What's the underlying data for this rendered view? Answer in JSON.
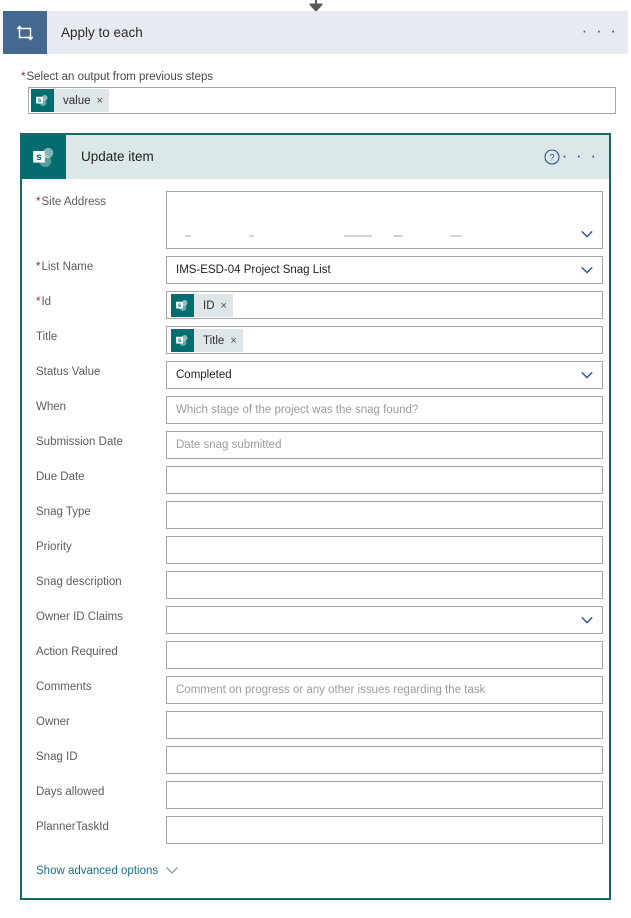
{
  "loop": {
    "icon": "repeat-loop-icon",
    "title": "Apply to each",
    "ellipsis": "· · ·",
    "select_output_label": "Select an output from previous steps",
    "required_star": "*",
    "token": {
      "label": "value",
      "close": "×",
      "icon": "sharepoint-icon"
    }
  },
  "action": {
    "icon": "sharepoint-icon",
    "title": "Update item",
    "help_icon": "help-circle-icon",
    "ellipsis": "· · ·",
    "advanced_options_label": "Show advanced options",
    "advanced_chevron": "chevron-down-icon",
    "fields": [
      {
        "label": "Site Address",
        "required": true,
        "type": "dropdown-redacted",
        "value": "",
        "placeholder": "",
        "tall": true
      },
      {
        "label": "List Name",
        "required": true,
        "type": "dropdown",
        "value": "IMS-ESD-04 Project Snag List",
        "placeholder": ""
      },
      {
        "label": "Id",
        "required": true,
        "type": "token",
        "value": "",
        "token": {
          "label": "ID",
          "close": "×"
        }
      },
      {
        "label": "Title",
        "required": false,
        "type": "token",
        "value": "",
        "token": {
          "label": "Title",
          "close": "×"
        }
      },
      {
        "label": "Status Value",
        "required": false,
        "type": "dropdown",
        "value": "Completed",
        "placeholder": ""
      },
      {
        "label": "When",
        "required": false,
        "type": "text",
        "value": "",
        "placeholder": "Which stage of the project was the snag found?"
      },
      {
        "label": "Submission Date",
        "required": false,
        "type": "text",
        "value": "",
        "placeholder": "Date snag submitted"
      },
      {
        "label": "Due Date",
        "required": false,
        "type": "text",
        "value": "",
        "placeholder": ""
      },
      {
        "label": "Snag Type",
        "required": false,
        "type": "text",
        "value": "",
        "placeholder": ""
      },
      {
        "label": "Priority",
        "required": false,
        "type": "text",
        "value": "",
        "placeholder": ""
      },
      {
        "label": "Snag description",
        "required": false,
        "type": "text",
        "value": "",
        "placeholder": ""
      },
      {
        "label": "Owner ID Claims",
        "required": false,
        "type": "dropdown",
        "value": "",
        "placeholder": ""
      },
      {
        "label": "Action Required",
        "required": false,
        "type": "text",
        "value": "",
        "placeholder": ""
      },
      {
        "label": "Comments",
        "required": false,
        "type": "text",
        "value": "",
        "placeholder": "Comment on progress or any other issues regarding the task"
      },
      {
        "label": "Owner",
        "required": false,
        "type": "text",
        "value": "",
        "placeholder": ""
      },
      {
        "label": "Snag ID",
        "required": false,
        "type": "text",
        "value": "",
        "placeholder": ""
      },
      {
        "label": "Days allowed",
        "required": false,
        "type": "text",
        "value": "",
        "placeholder": ""
      },
      {
        "label": "PlannerTaskId",
        "required": false,
        "type": "text",
        "value": "",
        "placeholder": ""
      }
    ]
  },
  "colors": {
    "loop_icon_bg": "#44688f",
    "loop_header_bg": "#e8eaf1",
    "sharepoint_teal": "#036c70",
    "action_header_bg": "#dce7e8",
    "action_border": "#18656a",
    "link_blue": "#1a6f8a",
    "chevron_blue": "#30559c",
    "required_red": "#a4262c",
    "placeholder_grey": "#9b9b9b",
    "field_border": "#a6a6a6"
  }
}
